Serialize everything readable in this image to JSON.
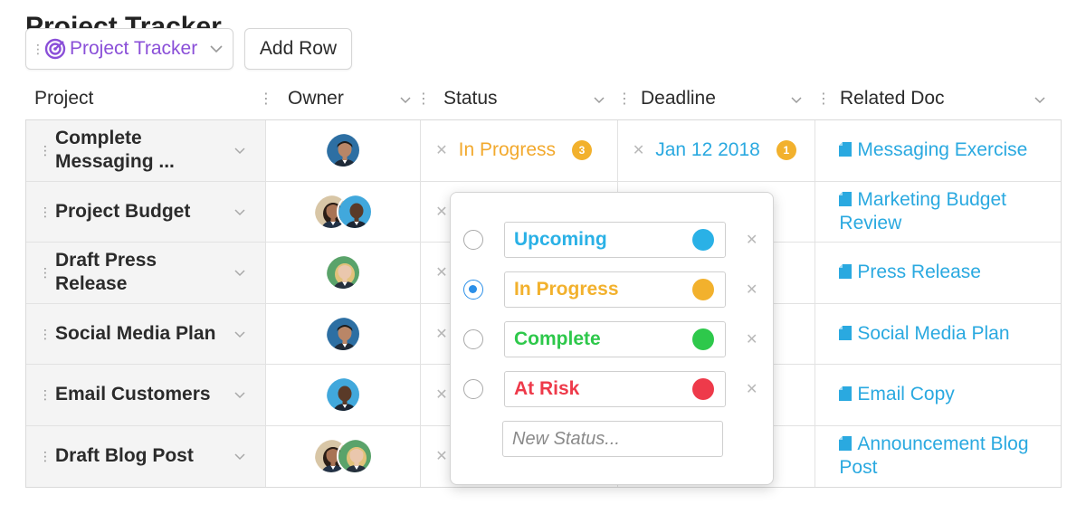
{
  "page": {
    "title": "Project Tracker"
  },
  "toolbar": {
    "tracker_label": "Project Tracker",
    "add_row_label": "Add Row"
  },
  "columns": [
    "Project",
    "Owner",
    "Status",
    "Deadline",
    "Related Doc"
  ],
  "rows": [
    {
      "project": "Complete Messaging ...",
      "owners": [
        "man-blue"
      ],
      "status": "In Progress",
      "status_count": "3",
      "deadline": "Jan 12 2018",
      "deadline_count": "1",
      "doc": "Messaging Exercise"
    },
    {
      "project": "Project Budget",
      "owners": [
        "woman-curly",
        "man-bald"
      ],
      "status": "",
      "deadline": "",
      "doc": "Marketing Budget Review"
    },
    {
      "project": "Draft Press Release",
      "owners": [
        "woman-blonde"
      ],
      "status": "",
      "deadline": "",
      "doc": "Press Release"
    },
    {
      "project": "Social Media Plan",
      "owners": [
        "man-blue"
      ],
      "status": "",
      "deadline": "",
      "doc": "Social Media Plan"
    },
    {
      "project": "Email Customers",
      "owners": [
        "man-bald"
      ],
      "status": "",
      "deadline": "",
      "doc": "Email Copy"
    },
    {
      "project": "Draft Blog Post",
      "owners": [
        "woman-curly",
        "woman-blonde"
      ],
      "status": "",
      "deadline": "",
      "doc": "Announcement Blog Post"
    }
  ],
  "status_popover": {
    "options": [
      {
        "label": "Upcoming",
        "color": "#2ab1e6",
        "selected": false
      },
      {
        "label": "In Progress",
        "color": "#f2b12d",
        "selected": true
      },
      {
        "label": "Complete",
        "color": "#2ec84b",
        "selected": false
      },
      {
        "label": "At Risk",
        "color": "#ee3a4a",
        "selected": false
      }
    ],
    "new_status_placeholder": "New Status..."
  },
  "colors": {
    "accent_purple": "#8a4fd8",
    "link_blue": "#2aa9e0",
    "in_progress": "#f2a92d"
  }
}
